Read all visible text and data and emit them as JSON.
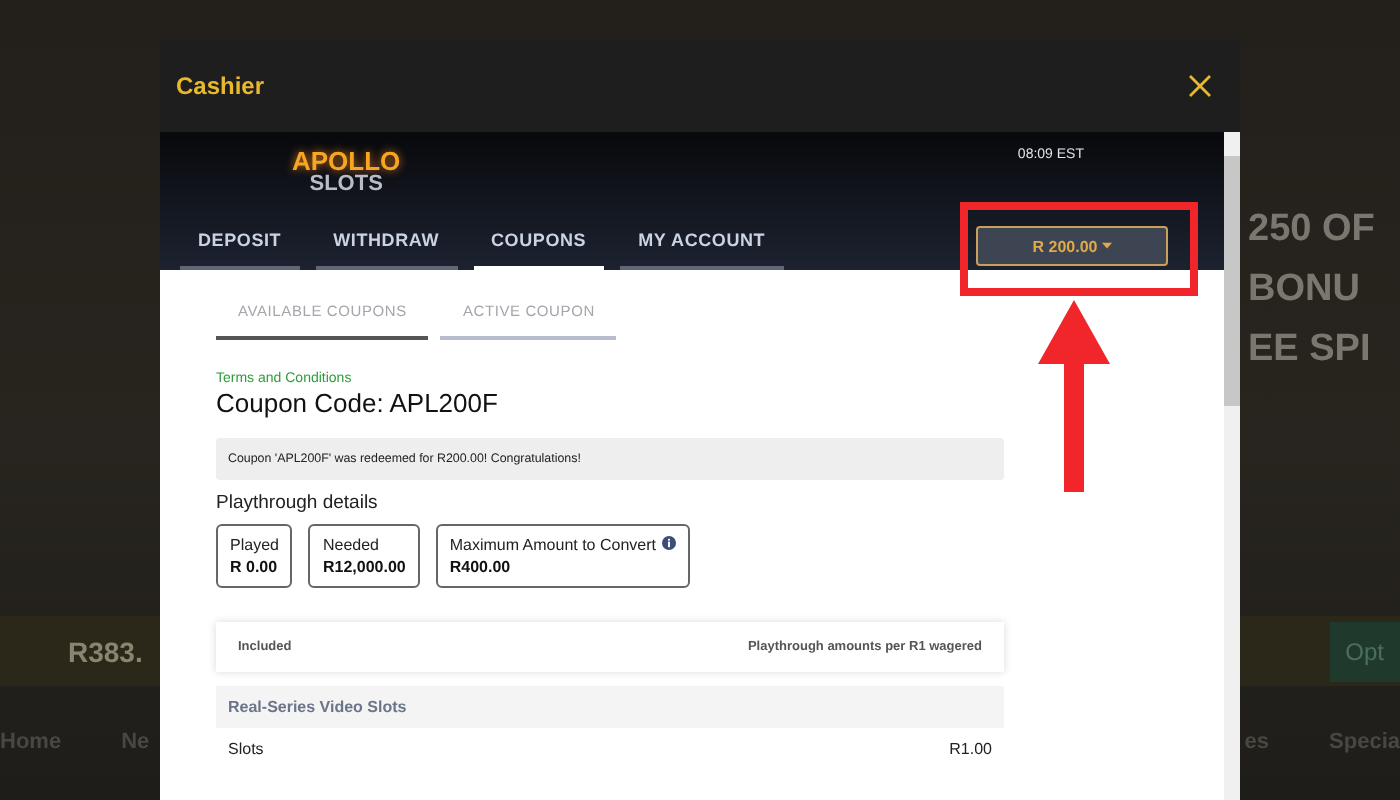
{
  "background_page": {
    "banner_lines": [
      "250 OF",
      "BONU",
      "EE SPI"
    ],
    "jackpot_amount": "R383.",
    "cta_button": "Opt",
    "nav_left": [
      "Home",
      "Ne"
    ],
    "nav_right": [
      "es",
      "Specia"
    ]
  },
  "cashier": {
    "title": "Cashier",
    "logo": {
      "top": "APOLLO",
      "bottom": "SLOTS"
    },
    "time": "08:09 EST",
    "tabs": [
      {
        "label": "DEPOSIT",
        "selected": false
      },
      {
        "label": "WITHDRAW",
        "selected": false
      },
      {
        "label": "COUPONS",
        "selected": true
      },
      {
        "label": "MY ACCOUNT",
        "selected": false
      }
    ],
    "balance": "R 200.00",
    "coupon_tabs": [
      {
        "label": "AVAILABLE COUPONS",
        "selected": true
      },
      {
        "label": "ACTIVE COUPON",
        "selected": false
      }
    ],
    "terms_link": "Terms and Conditions",
    "coupon_code": "Coupon Code: APL200F",
    "message": "Coupon 'APL200F' was redeemed for R200.00! Congratulations!",
    "playthrough_heading": "Playthrough details",
    "stats": [
      {
        "label": "Played",
        "value": "R 0.00",
        "info": false
      },
      {
        "label": "Needed",
        "value": "R12,000.00",
        "info": false
      },
      {
        "label": "Maximum Amount to Convert",
        "value": "R400.00",
        "info": true
      }
    ],
    "table": {
      "columns": [
        "Included",
        "Playthrough amounts per R1 wagered"
      ],
      "groups": [
        {
          "name": "Real-Series Video Slots",
          "rows": [
            {
              "game": "Slots",
              "amount": "R1.00"
            }
          ]
        }
      ]
    }
  }
}
